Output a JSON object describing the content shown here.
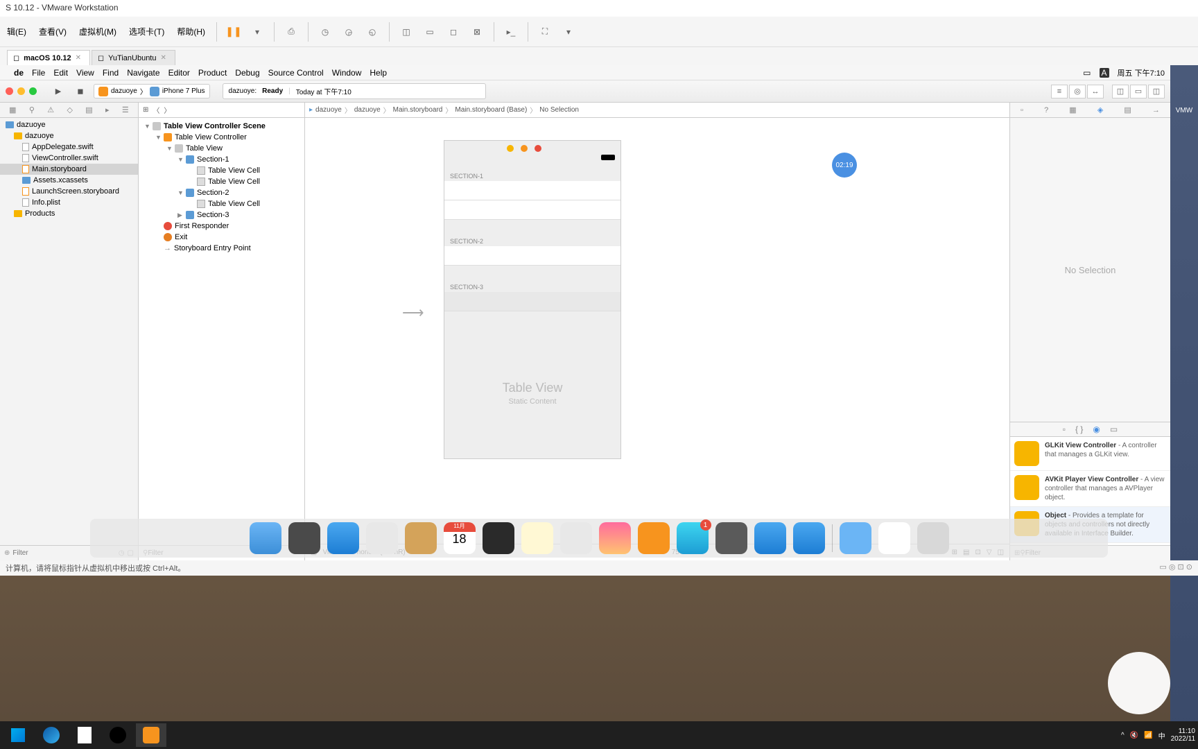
{
  "vmware": {
    "title": "S 10.12 - VMware Workstation",
    "menu": [
      "辑(E)",
      "查看(V)",
      "虚拟机(M)",
      "选项卡(T)",
      "帮助(H)"
    ],
    "tabs": [
      {
        "label": "macOS 10.12",
        "active": true
      },
      {
        "label": "YuTianUbuntu",
        "active": false
      }
    ],
    "status": "计算机，请将鼠标指针从虚拟机中移出或按 Ctrl+Alt。"
  },
  "macos_menu": {
    "items": [
      "de",
      "File",
      "Edit",
      "View",
      "Find",
      "Navigate",
      "Editor",
      "Product",
      "Debug",
      "Source Control",
      "Window",
      "Help"
    ],
    "clock": "周五 下午7:10"
  },
  "toolbar": {
    "scheme_app": "dazuoye",
    "scheme_device": "iPhone 7 Plus",
    "status_app": "dazuoye:",
    "status_ready": "Ready",
    "status_time": "Today at 下午7:10"
  },
  "timer": "02:19",
  "navigator": {
    "root": "dazuoye",
    "folder": "dazuoye",
    "files": [
      "AppDelegate.swift",
      "ViewController.swift",
      "Main.storyboard",
      "Assets.xcassets",
      "LaunchScreen.storyboard",
      "Info.plist"
    ],
    "products": "Products",
    "filter_ph": "Filter"
  },
  "outline": {
    "scene": "Table View Controller Scene",
    "vc": "Table View Controller",
    "tv": "Table View",
    "s1": "Section-1",
    "s2": "Section-2",
    "s3": "Section-3",
    "cell": "Table View Cell",
    "first_responder": "First Responder",
    "exit": "Exit",
    "entry": "Storyboard Entry Point",
    "filter_ph": "Filter"
  },
  "jumpbar": [
    "dazuoye",
    "dazuoye",
    "Main.storyboard",
    "Main.storyboard (Base)",
    "No Selection"
  ],
  "phone": {
    "sec1": "SECTION-1",
    "sec2": "SECTION-2",
    "sec3": "SECTION-3",
    "title": "Table View",
    "subtitle": "Static Content"
  },
  "canvas_bottom": {
    "view_as": "View as: iPhone 7 (wC hR)",
    "zoom": "75%"
  },
  "inspector": {
    "no_selection": "No Selection",
    "library": [
      {
        "name": "GLKit View Controller",
        "desc": " - A controller that manages a GLKit view."
      },
      {
        "name": "AVKit Player View Controller",
        "desc": " - A view controller that manages a AVPlayer object."
      },
      {
        "name": "Object",
        "desc": " - Provides a template for objects and controllers not directly available in Interface Builder."
      }
    ],
    "filter_ph": "Filter"
  },
  "dock_badge": "1",
  "win_tray": {
    "time": "11:10",
    "date": "2022/11",
    "ime": "中"
  },
  "right_strip": "VMW"
}
